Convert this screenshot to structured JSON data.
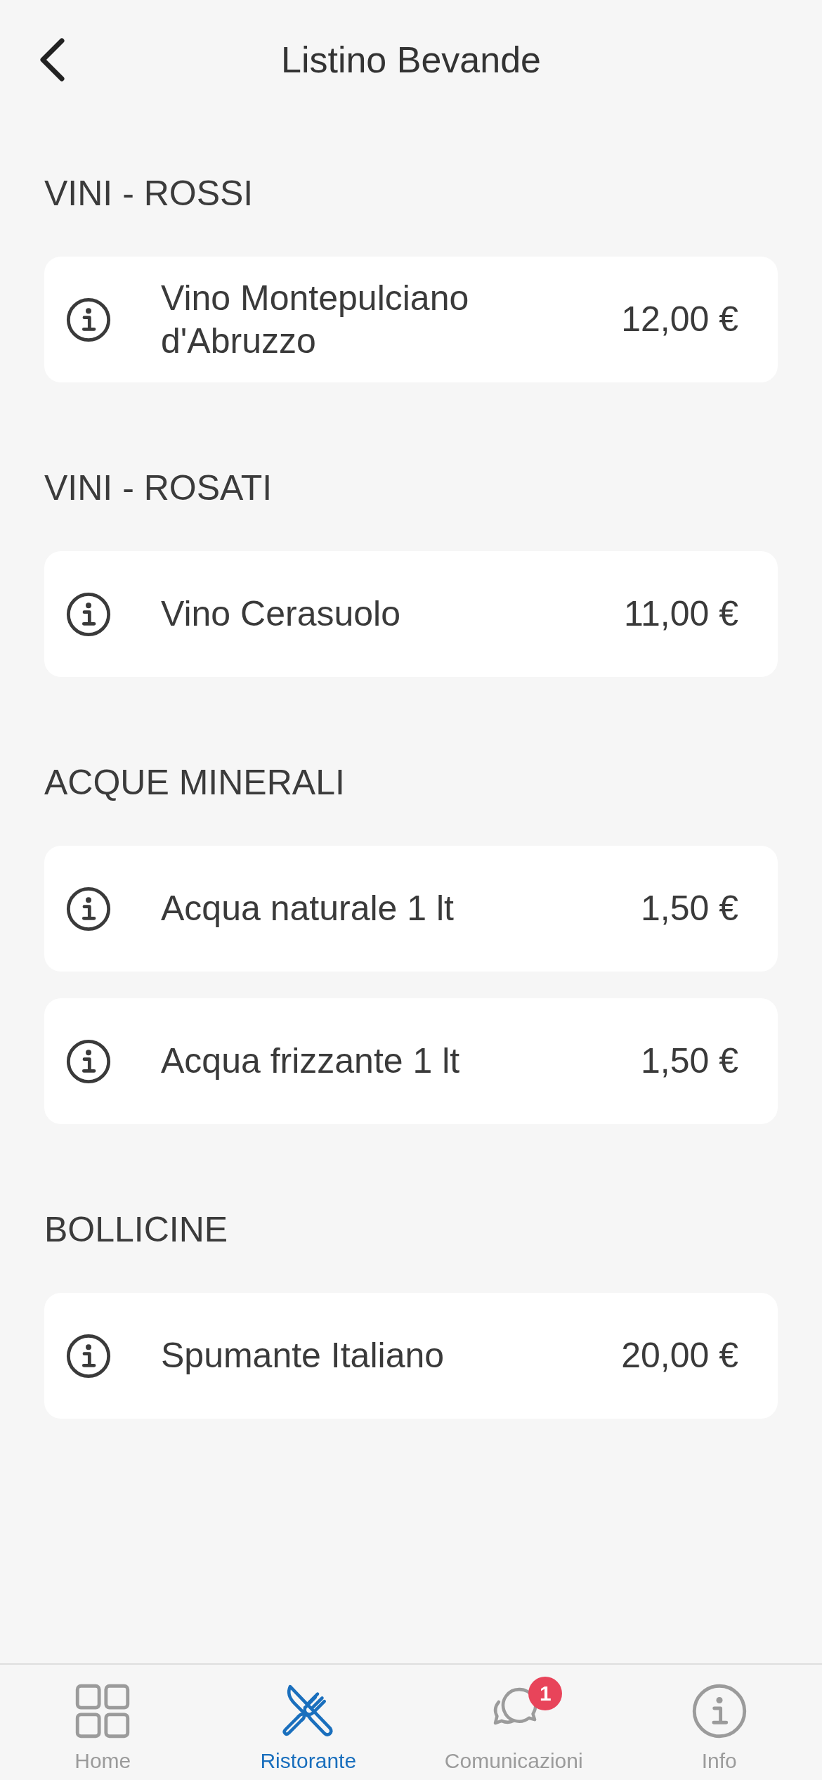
{
  "header": {
    "title": "Listino Bevande"
  },
  "sections": [
    {
      "title": "VINI - ROSSI",
      "items": [
        {
          "name": "Vino Montepulciano d'Abruzzo",
          "price": "12,00 €"
        }
      ]
    },
    {
      "title": "VINI - ROSATI",
      "items": [
        {
          "name": "Vino Cerasuolo",
          "price": "11,00 €"
        }
      ]
    },
    {
      "title": "ACQUE MINERALI",
      "items": [
        {
          "name": "Acqua naturale 1 lt",
          "price": "1,50 €"
        },
        {
          "name": "Acqua frizzante 1 lt",
          "price": "1,50 €"
        }
      ]
    },
    {
      "title": "BOLLICINE",
      "items": [
        {
          "name": "Spumante Italiano",
          "price": "20,00 €"
        }
      ]
    }
  ],
  "tab_bar": {
    "tabs": [
      {
        "label": "Home",
        "selected": false
      },
      {
        "label": "Ristorante",
        "selected": true
      },
      {
        "label": "Comunicazioni",
        "selected": false,
        "badge": "1"
      },
      {
        "label": "Info",
        "selected": false
      }
    ]
  }
}
